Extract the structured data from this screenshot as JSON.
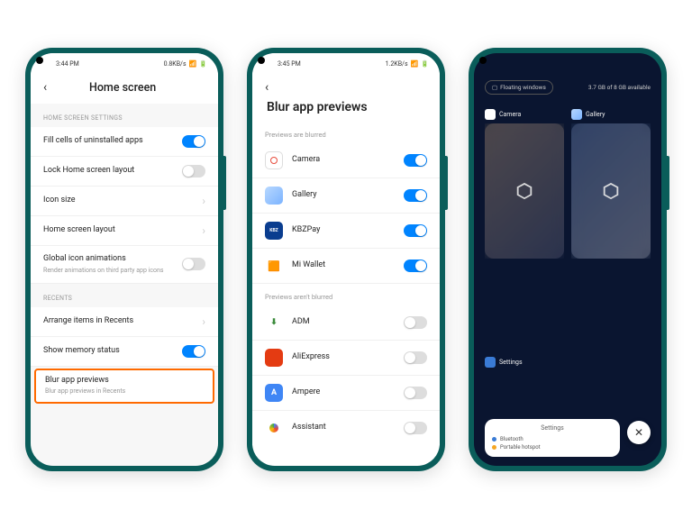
{
  "phone1": {
    "status": {
      "time": "3:44 PM",
      "net": "0.8KB/s"
    },
    "title": "Home screen",
    "sections": {
      "hs_settings": "HOME SCREEN SETTINGS",
      "recents": "RECENTS"
    },
    "rows": {
      "fill_cells": "Fill cells of uninstalled apps",
      "lock_layout": "Lock Home screen layout",
      "icon_size": "Icon size",
      "hs_layout": "Home screen layout",
      "global_anim": "Global icon animations",
      "global_anim_sub": "Render animations on third party app icons",
      "arrange": "Arrange items in Recents",
      "memory": "Show memory status",
      "blur": "Blur app previews",
      "blur_sub": "Blur app previews in Recents"
    }
  },
  "phone2": {
    "status": {
      "time": "3:45 PM",
      "net": "1.2KB/s"
    },
    "title": "Blur app previews",
    "section_blurred": "Previews are blurred",
    "section_not_blurred": "Previews aren't blurred",
    "apps_blurred": {
      "camera": "Camera",
      "gallery": "Gallery",
      "kbzpay": "KBZPay",
      "miwallet": "Mi Wallet"
    },
    "apps_not": {
      "adm": "ADM",
      "aliexpress": "AliExpress",
      "ampere": "Ampere",
      "assistant": "Assistant"
    }
  },
  "phone3": {
    "floating": "Floating windows",
    "memory": "3.7 GB of 8 GB available",
    "cards": {
      "camera": "Camera",
      "gallery": "Gallery",
      "settings": "Settings"
    },
    "settings_sheet": {
      "title": "Settings",
      "row1": "Bluetooth",
      "row2": "Portable hotspot"
    }
  }
}
